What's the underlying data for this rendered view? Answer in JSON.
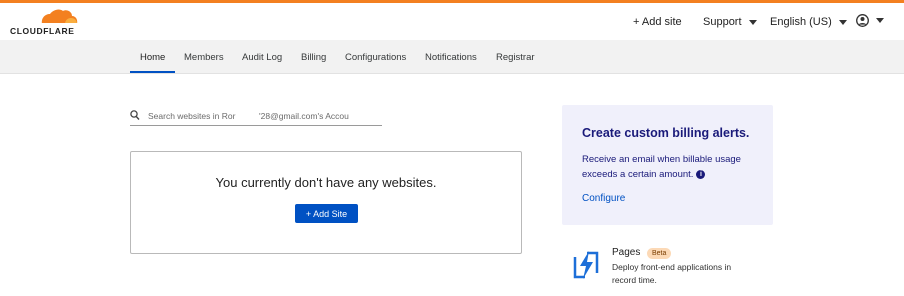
{
  "brand": {
    "name": "CLOUDFLARE",
    "accent_color": "#f38020",
    "primary_color": "#0051c3"
  },
  "header": {
    "add_site_label": "+ Add site",
    "support_label": "Support",
    "language_label": "English (US)",
    "account_icon": "user-circle-icon"
  },
  "nav": {
    "tabs": [
      {
        "label": "Home",
        "active": true
      },
      {
        "label": "Members",
        "active": false
      },
      {
        "label": "Audit Log",
        "active": false
      },
      {
        "label": "Billing",
        "active": false
      },
      {
        "label": "Configurations",
        "active": false
      },
      {
        "label": "Notifications",
        "active": false
      },
      {
        "label": "Registrar",
        "active": false
      }
    ]
  },
  "search": {
    "placeholder": "Search websites in Ror          '28@gmail.com's Accou",
    "icon": "search-icon"
  },
  "empty_state": {
    "message": "You currently don't have any websites.",
    "button_label": "+ Add Site"
  },
  "billing_alert": {
    "title": "Create custom billing alerts.",
    "description": "Receive an email when billable usage exceeds a certain amount.",
    "info_icon": "i",
    "link_label": "Configure"
  },
  "pages_promo": {
    "title": "Pages",
    "badge": "Beta",
    "description": "Deploy front-end applications in record time.",
    "icon": "lightning-bolt-icon"
  }
}
